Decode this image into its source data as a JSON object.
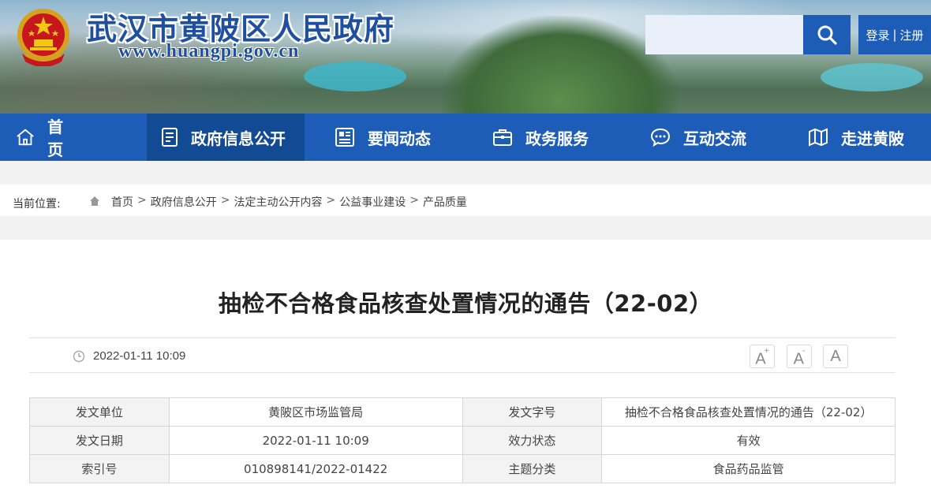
{
  "header": {
    "site_title": "武汉市黄陂区人民政府",
    "site_url": "www.huangpi.gov.cn",
    "search_placeholder": "",
    "login_label": "登录",
    "divider": "|",
    "register_label": "注册"
  },
  "nav": {
    "items": [
      {
        "label": "首　　页",
        "icon": "home-icon"
      },
      {
        "label": "政府信息公开",
        "icon": "document-icon"
      },
      {
        "label": "要闻动态",
        "icon": "news-icon"
      },
      {
        "label": "政务服务",
        "icon": "briefcase-icon"
      },
      {
        "label": "互动交流",
        "icon": "chat-icon"
      },
      {
        "label": "走进黄陂",
        "icon": "map-icon"
      }
    ],
    "active_index": 1
  },
  "breadcrumb": {
    "label": "当前位置:",
    "items": [
      "首页",
      "政府信息公开",
      "法定主动公开内容",
      "公益事业建设",
      "产品质量"
    ],
    "separator": ">"
  },
  "article": {
    "title": "抽检不合格食品核查处置情况的通告（22-02）",
    "publish_time": "2022-01-11 10:09",
    "font_buttons": [
      "A",
      "A",
      "A"
    ],
    "font_button_marks": [
      "+",
      "-",
      ""
    ]
  },
  "info_table": {
    "rows": [
      {
        "label1": "发文单位",
        "value1": "黄陂区市场监管局",
        "label2": "发文字号",
        "value2": "抽检不合格食品核查处置情况的通告（22-02）"
      },
      {
        "label1": "发文日期",
        "value1": "2022-01-11 10:09",
        "label2": "效力状态",
        "value2": "有效"
      },
      {
        "label1": "索引号",
        "value1": "010898141/2022-01422",
        "label2": "主题分类",
        "value2": "食品药品监管"
      }
    ]
  },
  "colors": {
    "primary": "#1d5db8",
    "nav_active": "#134a94",
    "title_text": "#222222"
  }
}
